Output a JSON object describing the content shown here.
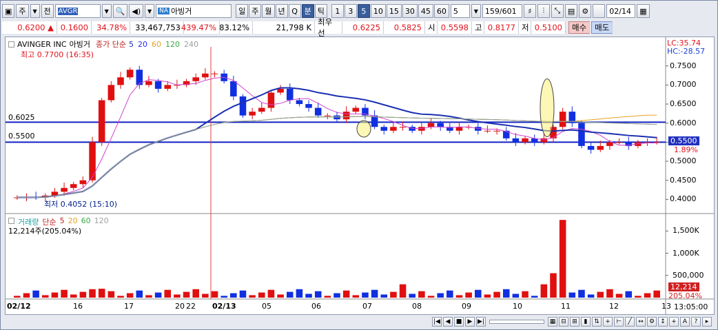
{
  "toolbar": {
    "type_label": "주",
    "market_label": "전",
    "code": "AVGR",
    "na_tag": "NA",
    "stock_name": "아빙거",
    "period_tabs": [
      "일",
      "주",
      "월",
      "년",
      "Q",
      "분",
      "틱"
    ],
    "active_period": "분",
    "intervals": [
      "1",
      "3",
      "5",
      "10",
      "15",
      "30",
      "45",
      "60"
    ],
    "active_interval": "5",
    "interval_value": "5",
    "count_value": "159",
    "count_total": "/601",
    "date_value": "02/14"
  },
  "quote": {
    "price": "0.6200",
    "change": "0.1600",
    "change_pct": "34.78%",
    "volume": "33,467,753",
    "vol_ratio": "439.47%",
    "strength": "83.12%",
    "amount": "21,798 K",
    "best_ask_label": "최우선",
    "best_ask": "0.6225",
    "best_bid": "0.5825",
    "open_label": "시",
    "open": "0.5598",
    "high_label": "고",
    "high": "0.8177",
    "low_label": "저",
    "low": "0.5100",
    "buy_label": "매수",
    "sell_label": "매도"
  },
  "price_panel": {
    "title": "AVINGER INC",
    "title_kr": "아빙거",
    "legend_label": "종가 단순",
    "ma": [
      "5",
      "20",
      "60",
      "120",
      "240"
    ],
    "ma_colors": [
      "#1a2fb0",
      "#2a2af0",
      "#e8a020",
      "#3aa84a",
      "#a0a0a0"
    ],
    "lc": "LC:35.74",
    "hc": "HC:-28.57",
    "max_annot": "최고 0.7700 (16:35)",
    "min_annot": "최저 0.4052 (15:10)",
    "hline1": "0.6025",
    "hline2": "0.5500",
    "current_price": "0.5500",
    "current_pct": "1.89%",
    "y_ticks": [
      "0.7500",
      "0.7000",
      "0.6500",
      "0.6000",
      "0.5500",
      "0.5000",
      "0.4500",
      "0.4000"
    ]
  },
  "volume_panel": {
    "title": "거래량",
    "legend_label": "단순",
    "ma": [
      "5",
      "20",
      "60",
      "120"
    ],
    "current": "12,214주(205.04%)",
    "y_ticks": [
      "1,500K",
      "1,000K",
      "500,000"
    ],
    "current_tag": "12,214",
    "pct_tag": "205.04%"
  },
  "x_axis": {
    "labels": [
      "02/12",
      "16",
      "17",
      "20",
      "22",
      "02/13",
      "05",
      "06",
      "07",
      "08",
      "09",
      "10",
      "11",
      "12",
      "13"
    ],
    "time": "13:05:00"
  },
  "chart_data": {
    "type": "candlestick",
    "title": "AVINGER INC 아빙거",
    "ylim": [
      0.37,
      0.8
    ],
    "hlines": [
      0.6025,
      0.55
    ],
    "series_close": [
      0.405,
      0.406,
      0.405,
      0.41,
      0.42,
      0.43,
      0.44,
      0.45,
      0.55,
      0.66,
      0.7,
      0.72,
      0.74,
      0.7,
      0.71,
      0.69,
      0.7,
      0.7,
      0.71,
      0.72,
      0.73,
      0.73,
      0.71,
      0.67,
      0.62,
      0.63,
      0.64,
      0.68,
      0.69,
      0.66,
      0.65,
      0.64,
      0.62,
      0.62,
      0.61,
      0.63,
      0.64,
      0.62,
      0.59,
      0.58,
      0.59,
      0.59,
      0.58,
      0.59,
      0.6,
      0.59,
      0.58,
      0.59,
      0.59,
      0.58,
      0.58,
      0.58,
      0.56,
      0.55,
      0.56,
      0.55,
      0.56,
      0.59,
      0.63,
      0.6,
      0.54,
      0.53,
      0.54,
      0.55,
      0.55,
      0.54,
      0.55,
      0.55,
      0.55
    ]
  }
}
